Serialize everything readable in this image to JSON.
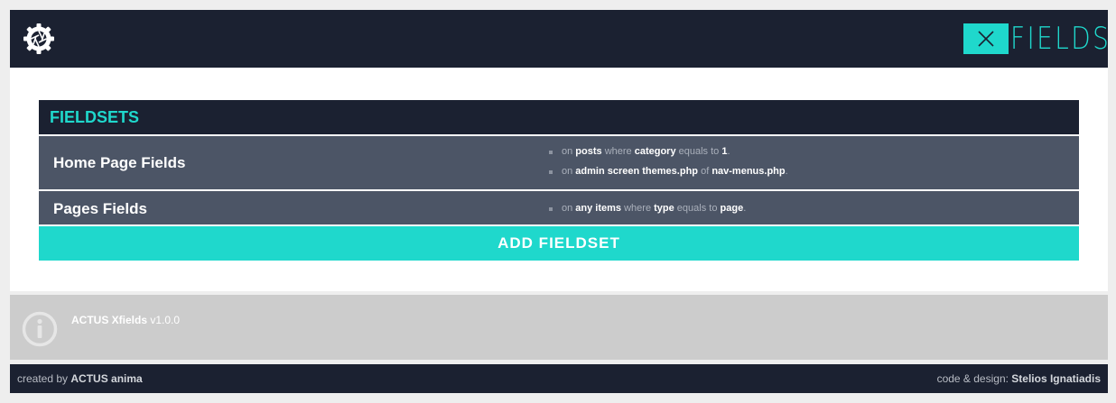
{
  "header": {
    "brand_text": "FIELDS",
    "logo_icon": "gear-aperture-icon",
    "brand_box_icon": "x-icon",
    "accent_color": "#1fd8cc",
    "dark_color": "#1b2131"
  },
  "fieldsets": {
    "title": "FIELDSETS",
    "items": [
      {
        "name": "Home Page Fields",
        "rules": [
          {
            "p1": "on ",
            "b1": "posts",
            "p2": " where ",
            "b2": "category",
            "p3": " equals to ",
            "b3": "1",
            "p4": "."
          },
          {
            "p1": "on ",
            "b1": "admin screen themes.php",
            "p2": " of ",
            "b2": "nav-menus.php",
            "p3": "",
            "b3": "",
            "p4": "."
          }
        ]
      },
      {
        "name": "Pages Fields",
        "rules": [
          {
            "p1": "on ",
            "b1": "any items",
            "p2": " where ",
            "b2": "type",
            "p3": " equals to ",
            "b3": "page",
            "p4": "."
          }
        ]
      }
    ],
    "add_button": "ADD FIELDSET"
  },
  "info": {
    "icon": "info-icon",
    "product": "ACTUS Xfields",
    "version": " v1.0.0"
  },
  "footer": {
    "left_prefix": "created by ",
    "left_strong": "ACTUS anima",
    "right_prefix": "code & design: ",
    "right_strong": "Stelios Ignatiadis"
  }
}
